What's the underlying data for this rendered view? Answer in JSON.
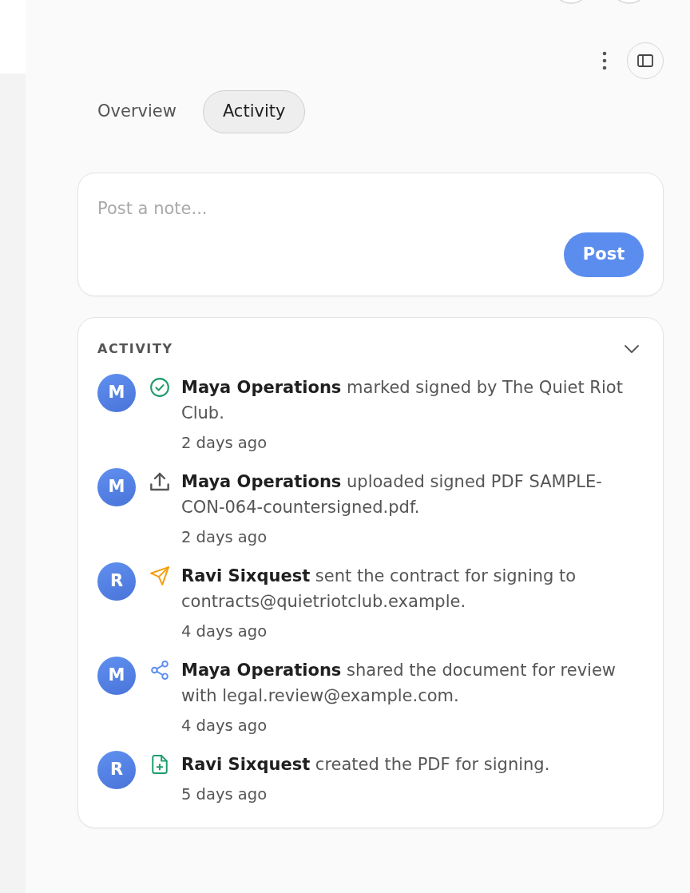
{
  "tabs": [
    {
      "label": "Overview",
      "selected": false
    },
    {
      "label": "Activity",
      "selected": true
    }
  ],
  "note": {
    "placeholder": "Post a note...",
    "button": "Post"
  },
  "activity": {
    "title": "ACTIVITY",
    "items": [
      {
        "kind": "signed",
        "initial": "M",
        "text": "**Maya Operations** marked signed by The Quiet Riot Club.",
        "time": "2 days ago"
      },
      {
        "kind": "upload",
        "initial": "M",
        "text": "**Maya Operations** uploaded signed PDF SAMPLE-CON-064-countersigned.pdf.",
        "time": "2 days ago"
      },
      {
        "kind": "send",
        "initial": "R",
        "text": "**Ravi Sixquest** sent the contract for signing to contracts@quietriotclub.example.",
        "time": "4 days ago"
      },
      {
        "kind": "share",
        "initial": "M",
        "text": "**Maya Operations** shared the document for review with legal.review@example.com.",
        "time": "4 days ago"
      },
      {
        "kind": "create",
        "initial": "R",
        "text": "**Ravi Sixquest** created the PDF for signing.",
        "time": "5 days ago"
      }
    ]
  }
}
